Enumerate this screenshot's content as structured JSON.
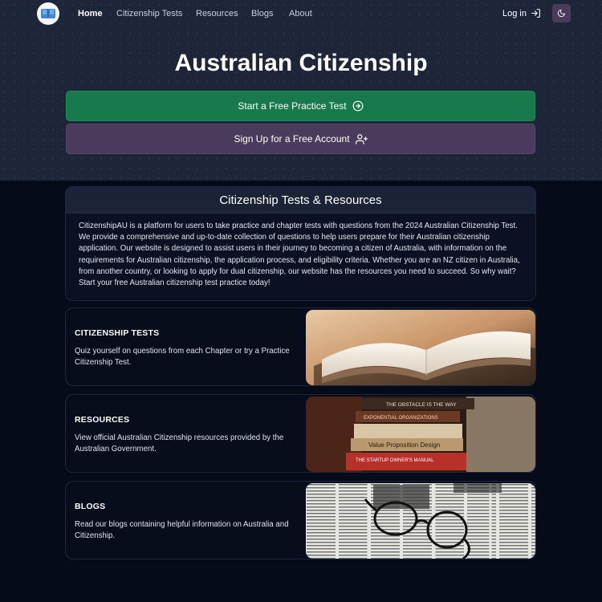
{
  "nav": {
    "logo_icon": "open-book-icon",
    "links": [
      {
        "label": "Home",
        "active": true
      },
      {
        "label": "Citizenship Tests",
        "active": false
      },
      {
        "label": "Resources",
        "active": false
      },
      {
        "label": "Blogs",
        "active": false
      },
      {
        "label": "About",
        "active": false
      }
    ],
    "login_label": "Log in",
    "login_icon": "log-in-icon",
    "theme_icon": "moon-icon"
  },
  "hero": {
    "title": "Australian Citizenship",
    "primary_cta": "Start a Free Practice Test",
    "primary_icon": "arrow-right-circle-icon",
    "secondary_cta": "Sign Up for a Free Account",
    "secondary_icon": "user-plus-icon"
  },
  "info": {
    "heading": "Citizenship Tests & Resources",
    "body": "CitizenshipAU is a platform for users to take practice and chapter tests with questions from the 2024 Australian Citizenship Test. We provide a comprehensive and up-to-date collection of questions to help users prepare for their Australian citizenship application. Our website is designed to assist users in their journey to becoming a citizen of Australia, with information on the requirements for Australian citizenship, the application process, and eligibility criteria. Whether you are an NZ citizen in Australia, from another country, or looking to apply for dual citizenship, our website has the resources you need to succeed. So why wait? Start your free Australian citizenship test practice today!"
  },
  "sections": [
    {
      "title": "CITIZENSHIP TESTS",
      "text": "Quiz yourself on questions from each Chapter or try a Practice Citizenship Test."
    },
    {
      "title": "RESOURCES",
      "text": "View official Australian Citizenship resources provided by the Australian Government."
    },
    {
      "title": "BLOGS",
      "text": "Read our blogs containing helpful information on Australia and Citizenship."
    }
  ],
  "book_spines": [
    "THE OBSTACLE IS THE WAY",
    "EXPONENTIAL ORGANIZATIONS",
    "Value Proposition Design",
    "THE STARTUP OWNER'S MANUAL"
  ],
  "colors": {
    "primary_green": "#187a4c",
    "secondary_purple": "#4a3a5c",
    "hero_bg": "#1d2638",
    "page_bg": "#060b1a"
  }
}
